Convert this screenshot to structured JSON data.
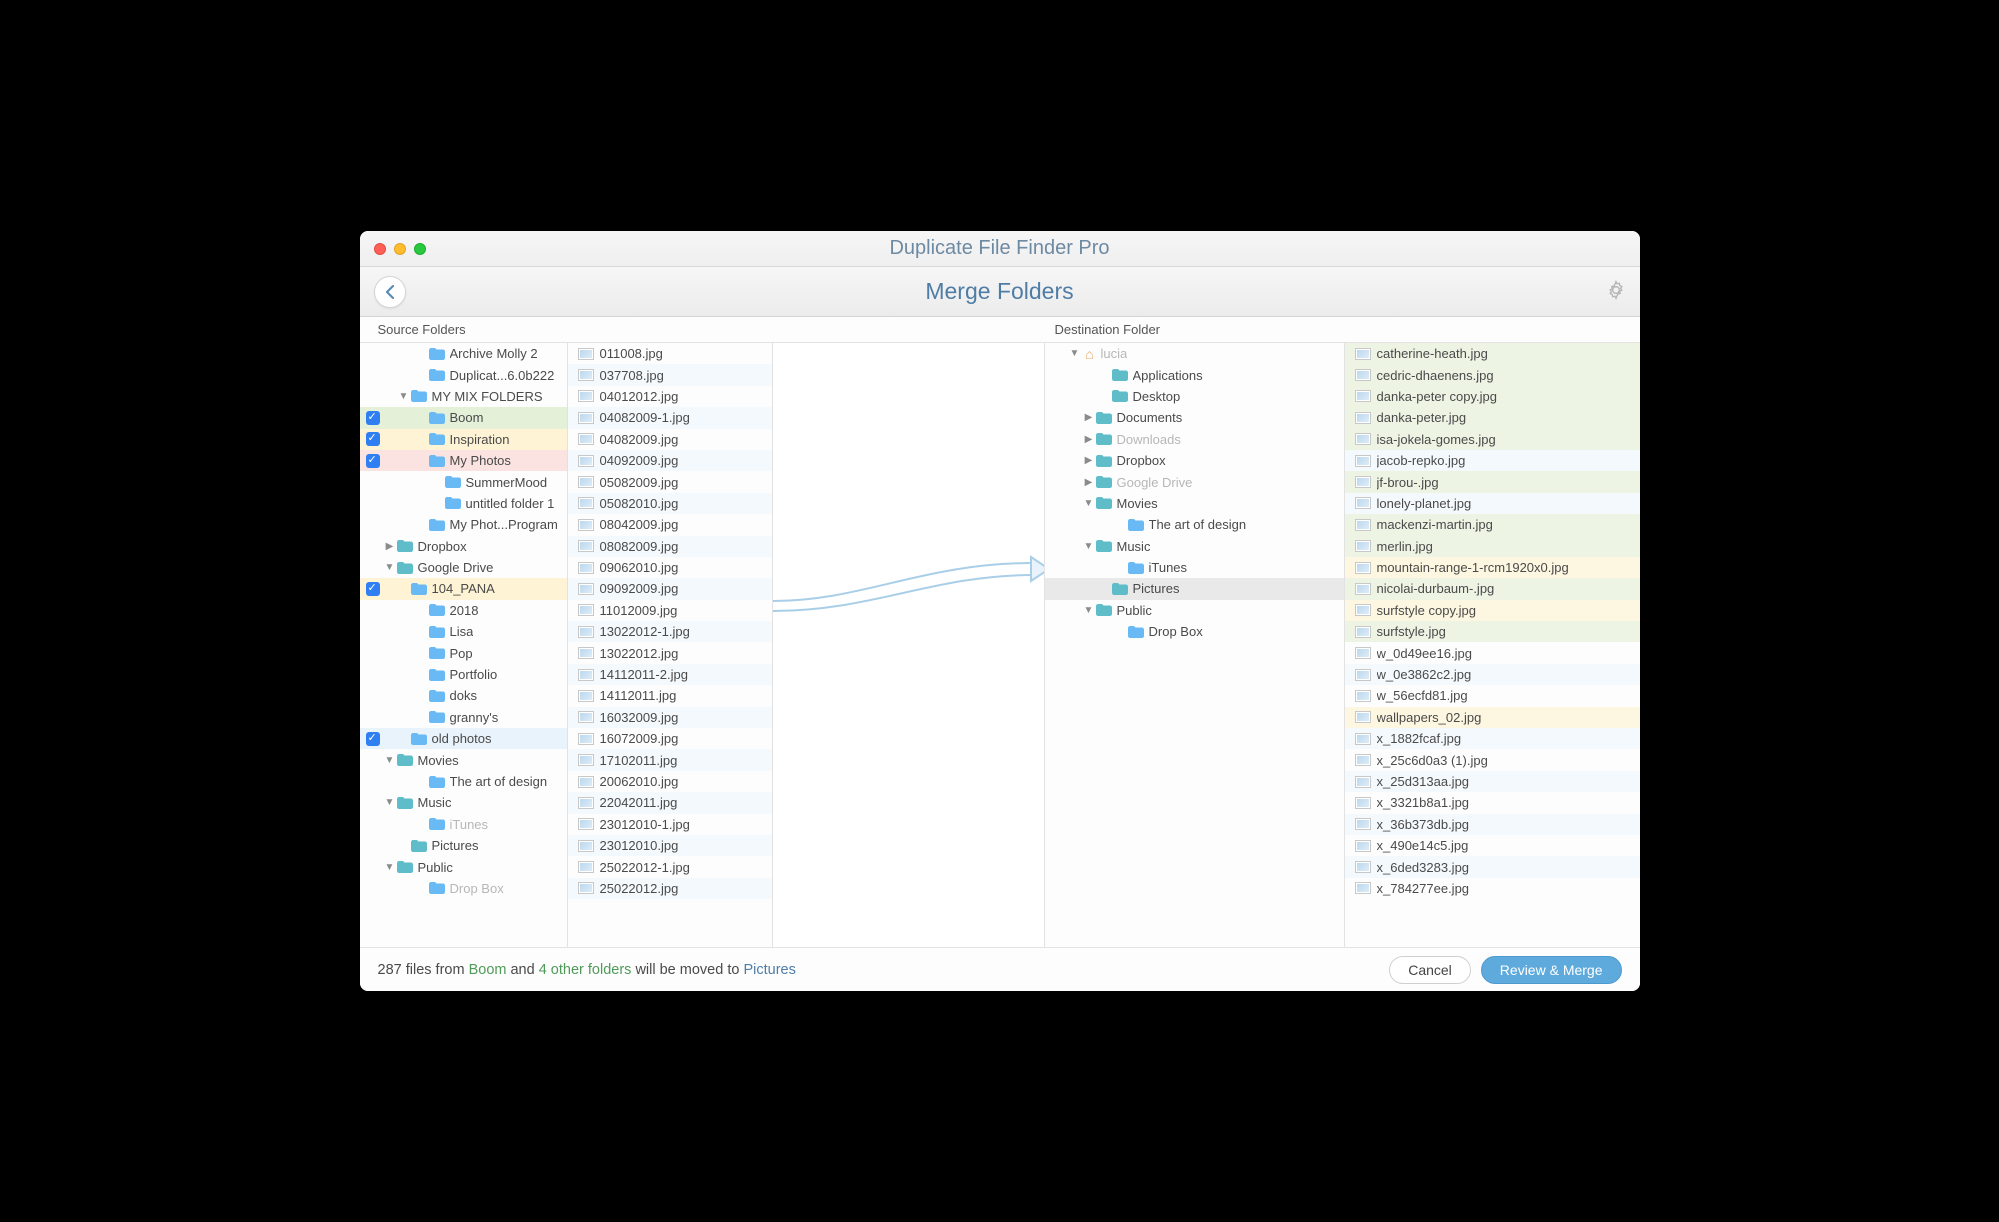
{
  "window": {
    "title": "Duplicate File Finder Pro",
    "subtitle": "Merge Folders"
  },
  "headers": {
    "source": "Source Folders",
    "destination": "Destination Folder"
  },
  "source_tree": [
    {
      "indent": 32,
      "label": "Archive Molly 2"
    },
    {
      "indent": 32,
      "label": "Duplicat...6.0b222"
    },
    {
      "indent": 14,
      "twisty": "down",
      "label": "MY MIX FOLDERS"
    },
    {
      "indent": 32,
      "cb": true,
      "label": "Boom",
      "hl": "hl-green"
    },
    {
      "indent": 32,
      "cb": true,
      "label": "Inspiration",
      "hl": "hl-yellow"
    },
    {
      "indent": 32,
      "cb": true,
      "label": "My Photos",
      "hl": "hl-red"
    },
    {
      "indent": 48,
      "label": "SummerMood"
    },
    {
      "indent": 48,
      "label": "untitled folder 1"
    },
    {
      "indent": 32,
      "label": "My Phot...Program"
    },
    {
      "indent": 0,
      "twisty": "right",
      "icon": "teal",
      "label": "Dropbox"
    },
    {
      "indent": 0,
      "twisty": "down",
      "icon": "teal",
      "label": "Google Drive"
    },
    {
      "indent": 14,
      "cb": true,
      "label": "104_PANA",
      "hl": "hl-yellow"
    },
    {
      "indent": 32,
      "label": "2018"
    },
    {
      "indent": 32,
      "label": "Lisa"
    },
    {
      "indent": 32,
      "label": "Pop"
    },
    {
      "indent": 32,
      "label": "Portfolio"
    },
    {
      "indent": 32,
      "label": "doks"
    },
    {
      "indent": 32,
      "label": "granny's"
    },
    {
      "indent": 14,
      "cb": true,
      "label": "old photos",
      "hl": "hl-blue"
    },
    {
      "indent": 0,
      "twisty": "down",
      "icon": "teal",
      "label": "Movies"
    },
    {
      "indent": 32,
      "label": "The art of design"
    },
    {
      "indent": 0,
      "twisty": "down",
      "icon": "teal",
      "label": "Music"
    },
    {
      "indent": 32,
      "label": "iTunes",
      "dim": true
    },
    {
      "indent": 14,
      "icon": "teal",
      "label": "Pictures"
    },
    {
      "indent": 0,
      "twisty": "down",
      "icon": "teal",
      "label": "Public"
    },
    {
      "indent": 32,
      "label": "Drop Box",
      "dim": true
    }
  ],
  "source_files": [
    "011008.jpg",
    "037708.jpg",
    "04012012.jpg",
    "04082009-1.jpg",
    "04082009.jpg",
    "04092009.jpg",
    "05082009.jpg",
    "05082010.jpg",
    "08042009.jpg",
    "08082009.jpg",
    "09062010.jpg",
    "09092009.jpg",
    "11012009.jpg",
    "13022012-1.jpg",
    "13022012.jpg",
    "14112011-2.jpg",
    "14112011.jpg",
    "16032009.jpg",
    "16072009.jpg",
    "17102011.jpg",
    "20062010.jpg",
    "22042011.jpg",
    "23012010-1.jpg",
    "23012010.jpg",
    "25022012-1.jpg",
    "25022012.jpg"
  ],
  "dest_tree": [
    {
      "indent": 0,
      "twisty": "down",
      "home": true,
      "label": "lucia",
      "dim": true
    },
    {
      "indent": 30,
      "icon": "teal",
      "label": "Applications"
    },
    {
      "indent": 30,
      "icon": "teal",
      "label": "Desktop"
    },
    {
      "indent": 14,
      "twisty": "right",
      "icon": "teal",
      "label": "Documents"
    },
    {
      "indent": 14,
      "twisty": "right",
      "icon": "teal",
      "label": "Downloads",
      "dim": true
    },
    {
      "indent": 14,
      "twisty": "right",
      "icon": "teal",
      "label": "Dropbox"
    },
    {
      "indent": 14,
      "twisty": "right",
      "icon": "teal",
      "label": "Google Drive",
      "dim": true
    },
    {
      "indent": 14,
      "twisty": "down",
      "icon": "teal",
      "label": "Movies"
    },
    {
      "indent": 46,
      "label": "The art of design"
    },
    {
      "indent": 14,
      "twisty": "down",
      "icon": "teal",
      "label": "Music"
    },
    {
      "indent": 46,
      "label": "iTunes"
    },
    {
      "indent": 30,
      "icon": "teal",
      "label": "Pictures",
      "selected": true
    },
    {
      "indent": 14,
      "twisty": "down",
      "icon": "teal",
      "label": "Public"
    },
    {
      "indent": 46,
      "label": "Drop Box"
    }
  ],
  "dest_files": [
    {
      "n": "catherine-heath.jpg",
      "hl": "hl-lgreen"
    },
    {
      "n": "cedric-dhaenens.jpg",
      "hl": "hl-lgreen"
    },
    {
      "n": "danka-peter copy.jpg",
      "hl": "hl-lgreen"
    },
    {
      "n": "danka-peter.jpg",
      "hl": "hl-lgreen"
    },
    {
      "n": "isa-jokela-gomes.jpg",
      "hl": "hl-lgreen"
    },
    {
      "n": "jacob-repko.jpg",
      "hl": "hl-stripe"
    },
    {
      "n": "jf-brou-.jpg",
      "hl": "hl-lgreen"
    },
    {
      "n": "lonely-planet.jpg",
      "hl": "hl-stripe"
    },
    {
      "n": "mackenzi-martin.jpg",
      "hl": "hl-lgreen"
    },
    {
      "n": "merlin.jpg",
      "hl": "hl-lgreen"
    },
    {
      "n": "mountain-range-1-rcm1920x0.jpg",
      "hl": "hl-lyellow"
    },
    {
      "n": "nicolai-durbaum-.jpg",
      "hl": "hl-lgreen"
    },
    {
      "n": "surfstyle copy.jpg",
      "hl": "hl-lyellow"
    },
    {
      "n": "surfstyle.jpg",
      "hl": "hl-lgreen"
    },
    {
      "n": "w_0d49ee16.jpg",
      "hl": ""
    },
    {
      "n": "w_0e3862c2.jpg",
      "hl": "hl-stripe"
    },
    {
      "n": "w_56ecfd81.jpg",
      "hl": ""
    },
    {
      "n": "wallpapers_02.jpg",
      "hl": "hl-lyellow"
    },
    {
      "n": "x_1882fcaf.jpg",
      "hl": "hl-stripe"
    },
    {
      "n": "x_25c6d0a3 (1).jpg",
      "hl": ""
    },
    {
      "n": "x_25d313aa.jpg",
      "hl": "hl-stripe"
    },
    {
      "n": "x_3321b8a1.jpg",
      "hl": ""
    },
    {
      "n": "x_36b373db.jpg",
      "hl": "hl-stripe"
    },
    {
      "n": "x_490e14c5.jpg",
      "hl": ""
    },
    {
      "n": "x_6ded3283.jpg",
      "hl": "hl-stripe"
    },
    {
      "n": "x_784277ee.jpg",
      "hl": ""
    }
  ],
  "status": {
    "count": "287",
    "t1": " files from ",
    "src": "Boom",
    "t2": " and ",
    "others": "4 other folders",
    "t3": " will be moved to ",
    "dest": "Pictures"
  },
  "buttons": {
    "cancel": "Cancel",
    "merge": "Review & Merge"
  }
}
